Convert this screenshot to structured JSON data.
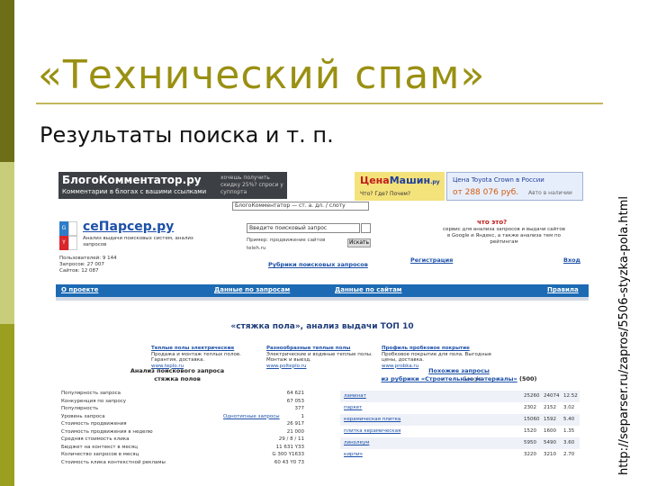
{
  "slide": {
    "title": "«Технический спам»",
    "subtitle": "Результаты поиска и т. п.",
    "source_url": "http://separser.ru/zapros/5506-styzka-pola.html",
    "colors": {
      "title": "#9a9012",
      "bar_dark": "#6e6e17",
      "bar_light": "#c7cd78",
      "bar_mid": "#9a9f1f"
    }
  },
  "screenshot": {
    "ads": {
      "left_brand": "БлогоКомментатор.ру",
      "left_tag": "Комментарии в блогах с вашими ссылками",
      "left_promo": "хочешь получить скидку 25%? спроси у суппорта",
      "mid_brand_a": "Цена",
      "mid_brand_b": "Машин",
      "mid_brand_c": ".ру",
      "mid_question": "Что? Где? Почем?",
      "right_title": "Цена Toyota Crown в России",
      "right_price": "от 288 076 руб.",
      "right_more": "Авто в наличии"
    },
    "top_search": "БлогоКомментатор — ст. а. дл. / слоту",
    "logo": {
      "name": "сеПарсер.ру",
      "tagline": "Анализ выдачи поисковых систем, анализ запросов"
    },
    "search": {
      "placeholder": "Введите поисковый запрос",
      "example": "Пример: продвижение сайтов",
      "example2": "teleh.ru",
      "button": "Искать"
    },
    "what": {
      "title": "что это?",
      "text": "сервис для анализа запросов и выдачи сайтов в Google и Яндекс, а также анализа тем по рейтингам"
    },
    "stats": [
      "Пользователей: 9 144",
      "Запросов: 27 007",
      "Сайтов: 12 087"
    ],
    "links": {
      "rubric": "Рубрики поисковых запросов",
      "register": "Регистрация",
      "login": "Вход"
    },
    "nav": [
      "О проекте",
      "Данные по запросам",
      "Данные по сайтам",
      "Правила"
    ],
    "headline": "«стяжка пола», анализ выдачи ТОП 10",
    "context_ads": [
      {
        "title": "Теплые полы электрические",
        "body": "Продажа и монтаж теплых полов. Гарантия, доставка.",
        "site": "www.teplo.ru"
      },
      {
        "title": "Разнообразные теплые полы",
        "body": "Электрические и водяные теплые полы. Монтаж и выезд.",
        "site": "www.polteplo.ru"
      },
      {
        "title": "Профиль пробковое покрытие",
        "body": "Пробковое покрытие для пола. Выгодные цены, доставка.",
        "site": "www.probka.ru"
      }
    ],
    "google_label": "Google",
    "analysis": {
      "title_line1": "Анализ поискового запроса",
      "title_line2": "стяжка полов"
    },
    "left_rows": [
      {
        "k": "Популярность запроса",
        "v": "64 621",
        "lnk": ""
      },
      {
        "k": "Конкуренция по запросу",
        "v": "67 053",
        "lnk": ""
      },
      {
        "k": "Популярность",
        "v": "377",
        "lnk": ""
      },
      {
        "k": "Уровень запроса",
        "v": "1",
        "lnk": "Однотипные запросы"
      },
      {
        "k": "Стоимость продвижения",
        "v": "26 917",
        "lnk": ""
      },
      {
        "k": "Стоимость продвижения в неделю",
        "v": "21 000",
        "lnk": ""
      },
      {
        "k": "Средняя стоимость клика",
        "v": "29 / 8 / 11",
        "lnk": ""
      },
      {
        "k": "Бюджет на контекст в месяц",
        "v": "11 631 Y33",
        "lnk": ""
      },
      {
        "k": "Количество запросов в месяц",
        "v": "G 300 Y1633",
        "lnk": ""
      },
      {
        "k": "Стоимость клика контекстной рекламы",
        "v": "60 43 Y0 73",
        "lnk": ""
      }
    ],
    "similar": {
      "title": "Похожие запросы",
      "subtitle": "из рубрики «Строительные материалы»",
      "count": "(500)"
    },
    "right_rows": [
      {
        "n": "ламинат",
        "c1": "25260",
        "c2": "24074",
        "c3": "12.52"
      },
      {
        "n": "паркет",
        "c1": "2302",
        "c2": "2152",
        "c3": "3.02"
      },
      {
        "n": "керамическая плитка",
        "c1": "15060",
        "c2": "1592",
        "c3": "5.40"
      },
      {
        "n": "плитка керамическая",
        "c1": "1520",
        "c2": "1600",
        "c3": "1.35"
      },
      {
        "n": "линолеум",
        "c1": "5950",
        "c2": "5490",
        "c3": "3.60"
      },
      {
        "n": "кирпич",
        "c1": "3220",
        "c2": "3210",
        "c3": "2.70"
      }
    ]
  }
}
